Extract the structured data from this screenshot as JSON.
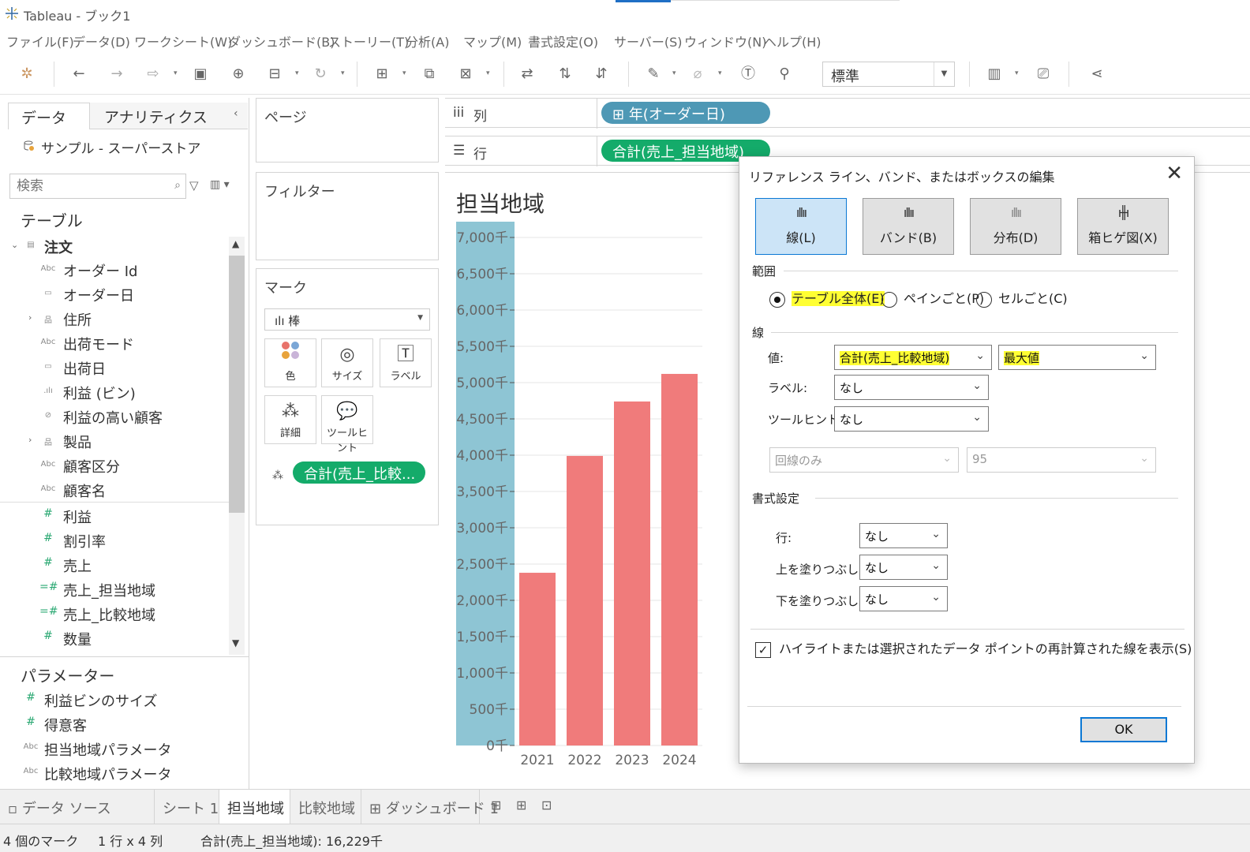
{
  "window": {
    "title": "Tableau - ブック1"
  },
  "menu": [
    "ファイル(F)",
    "データ(D)",
    "ワークシート(W)",
    "ダッシュボード(B)",
    "ストーリー(T)",
    "分析(A)",
    "マップ(M)",
    "書式設定(O)",
    "サーバー(S)",
    "ウィンドウ(N)",
    "ヘルプ(H)"
  ],
  "toolbar": {
    "fit_select": "標準"
  },
  "data_pane": {
    "tabs": [
      "データ",
      "アナリティクス"
    ],
    "datasource": "サンプル - スーパーストア",
    "search_placeholder": "検索",
    "tables_title": "テーブル",
    "table_name": "注文",
    "fields": [
      {
        "icon": "Abc",
        "label": "オーダー Id"
      },
      {
        "icon": "▭",
        "label": "オーダー日"
      },
      {
        "icon": "品",
        "label": "住所"
      },
      {
        "icon": "Abc",
        "label": "出荷モード"
      },
      {
        "icon": "▭",
        "label": "出荷日"
      },
      {
        "icon": ".ılı",
        "label": "利益 (ビン)"
      },
      {
        "icon": "⊘",
        "label": "利益の高い顧客"
      },
      {
        "icon": "品",
        "label": "製品"
      },
      {
        "icon": "Abc",
        "label": "顧客区分"
      },
      {
        "icon": "Abc",
        "label": "顧客名"
      },
      {
        "icon": "#",
        "label": "利益"
      },
      {
        "icon": "#",
        "label": "割引率"
      },
      {
        "icon": "#",
        "label": "売上"
      },
      {
        "icon": "=#",
        "label": "売上_担当地域"
      },
      {
        "icon": "=#",
        "label": "売上_比較地域"
      },
      {
        "icon": "#",
        "label": "数量"
      }
    ],
    "params_title": "パラメーター",
    "params": [
      {
        "icon": "#",
        "label": "利益ビンのサイズ"
      },
      {
        "icon": "#",
        "label": "得意客"
      },
      {
        "icon": "Abc",
        "label": "担当地域パラメータ"
      },
      {
        "icon": "Abc",
        "label": "比較地域パラメータ"
      }
    ]
  },
  "cards": {
    "pages": "ページ",
    "filters": "フィルター",
    "marks": "マーク",
    "marks_type": "棒",
    "mark_buttons": [
      "色",
      "サイズ",
      "ラベル",
      "詳細",
      "ツールヒント"
    ],
    "marks_pill": "合計(売上_比較..."
  },
  "shelves": {
    "columns_label": "列",
    "rows_label": "行",
    "columns_pill": "年(オーダー日)",
    "rows_pill": "合計(売上_担当地域)"
  },
  "chart_data": {
    "type": "bar",
    "title": "担当地域",
    "categories": [
      "2021",
      "2022",
      "2023",
      "2024"
    ],
    "values": [
      2380,
      3990,
      4740,
      5120
    ],
    "y_unit_suffix": "千",
    "yticks": [
      0,
      500,
      1000,
      1500,
      2000,
      2500,
      3000,
      3500,
      4000,
      4500,
      5000,
      5500,
      6000,
      6500,
      7000
    ],
    "ytick_labels": [
      "0千",
      "500千",
      "1,000千",
      "1,500千",
      "2,000千",
      "2,500千",
      "3,000千",
      "3,500千",
      "4,000千",
      "4,500千",
      "5,000千",
      "5,500千",
      "6,000千",
      "6,500千",
      "7,000千"
    ],
    "ylim": [
      0,
      7000
    ],
    "bar_color": "#f07b7b",
    "axis_band_color": "#8ec5d4"
  },
  "dialog": {
    "title": "リファレンス ライン、バンド、またはボックスの編集",
    "tabs": [
      "線(L)",
      "バンド(B)",
      "分布(D)",
      "箱ヒゲ図(X)"
    ],
    "scope_title": "範囲",
    "scope_options": [
      "テーブル全体(E)",
      "ペインごと(P)",
      "セルごと(C)"
    ],
    "line_title": "線",
    "value_label": "値:",
    "value_field": "合計(売上_比較地域)",
    "value_agg": "最大値",
    "label_label": "ラベル:",
    "label_value": "なし",
    "tooltip_label": "ツールヒント:",
    "tooltip_value": "なし",
    "ci_value": "回線のみ",
    "ci_percent": "95",
    "format_title": "書式設定",
    "row_label": "行:",
    "row_value": "なし",
    "fill_above_label": "上を塗りつぶし:",
    "fill_above_value": "なし",
    "fill_below_label": "下を塗りつぶし:",
    "fill_below_value": "なし",
    "checkbox_label": "ハイライトまたは選択されたデータ ポイントの再計算された線を表示(S)",
    "ok": "OK"
  },
  "sheet_tabs": [
    "データ ソース",
    "シート 1",
    "担当地域",
    "比較地域",
    "ダッシュボード 1"
  ],
  "status": {
    "marks": "4 個のマーク",
    "dims": "1 行 x 4 列",
    "sum": "合計(売上_担当地域): 16,229千"
  }
}
